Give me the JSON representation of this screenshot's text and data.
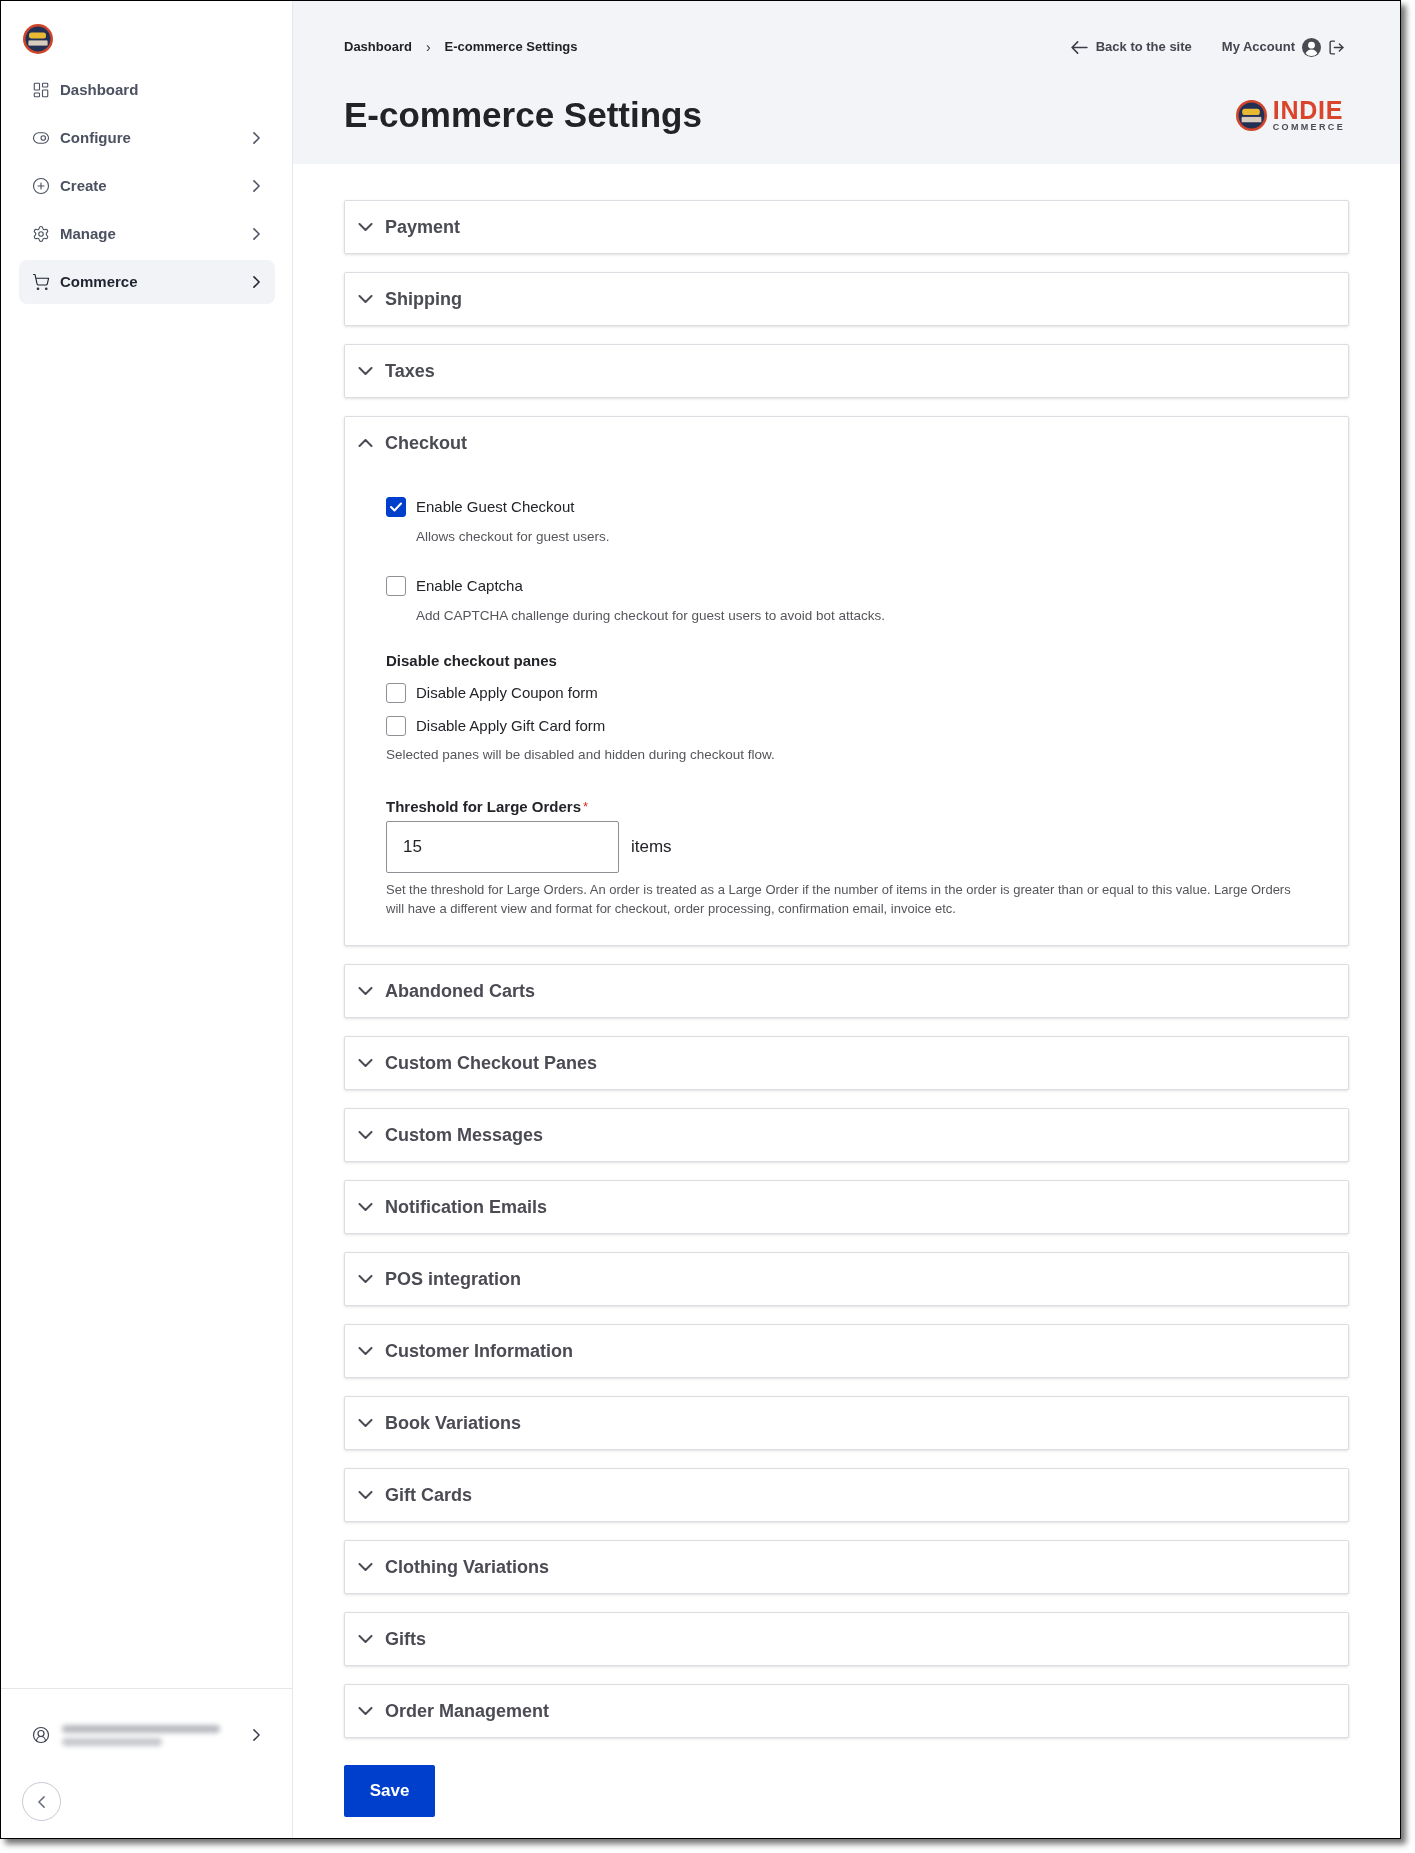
{
  "sidebar": {
    "nav_items": [
      {
        "label": "Dashboard",
        "selected": false,
        "has_submenu": false
      },
      {
        "label": "Configure",
        "selected": false,
        "has_submenu": true
      },
      {
        "label": "Create",
        "selected": false,
        "has_submenu": true
      },
      {
        "label": "Manage",
        "selected": false,
        "has_submenu": true
      },
      {
        "label": "Commerce",
        "selected": true,
        "has_submenu": true
      }
    ]
  },
  "header": {
    "breadcrumbs": [
      "Dashboard",
      "E-commerce Settings"
    ],
    "breadcrumb_separator": "›",
    "back_link": "Back to the site",
    "account_link": "My Account",
    "title": "E-commerce Settings",
    "brand": {
      "name": "INDIE",
      "tagline": "COMMERCE"
    }
  },
  "sections": [
    {
      "title": "Payment",
      "expanded": false
    },
    {
      "title": "Shipping",
      "expanded": false
    },
    {
      "title": "Taxes",
      "expanded": false
    },
    {
      "title": "Checkout",
      "expanded": true,
      "fields": [
        {
          "kind": "checkbox",
          "label": "Enable Guest Checkout",
          "checked": true,
          "description": "Allows checkout for guest users."
        },
        {
          "kind": "checkbox",
          "label": "Enable Captcha",
          "checked": false,
          "description": "Add CAPTCHA challenge during checkout for guest users to avoid bot attacks."
        },
        {
          "kind": "checkbox_group",
          "heading": "Disable checkout panes",
          "options": [
            {
              "label": "Disable Apply Coupon form",
              "checked": false
            },
            {
              "label": "Disable Apply Gift Card form",
              "checked": false
            }
          ],
          "description": "Selected panes will be disabled and hidden during checkout flow."
        },
        {
          "kind": "number",
          "label": "Threshold for Large Orders",
          "required_mark": "*",
          "value": "15",
          "suffix": "items",
          "description": "Set the threshold for Large Orders. An order is treated as a Large Order if the number of items in the order is greater than or equal to this value. Large Orders will have a different view and format for checkout, order processing, confirmation email, invoice etc."
        }
      ]
    },
    {
      "title": "Abandoned Carts",
      "expanded": false
    },
    {
      "title": "Custom Checkout Panes",
      "expanded": false
    },
    {
      "title": "Custom Messages",
      "expanded": false
    },
    {
      "title": "Notification Emails",
      "expanded": false
    },
    {
      "title": "POS integration",
      "expanded": false
    },
    {
      "title": "Customer Information",
      "expanded": false
    },
    {
      "title": "Book Variations",
      "expanded": false
    },
    {
      "title": "Gift Cards",
      "expanded": false
    },
    {
      "title": "Clothing Variations",
      "expanded": false
    },
    {
      "title": "Gifts",
      "expanded": false
    },
    {
      "title": "Order Management",
      "expanded": false
    }
  ],
  "save_button": "Save"
}
